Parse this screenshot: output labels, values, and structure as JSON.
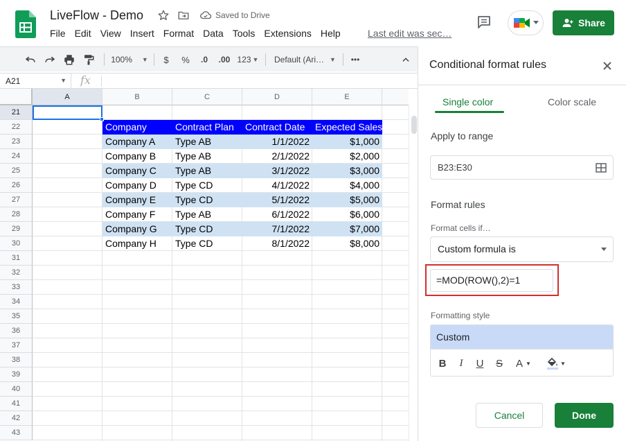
{
  "app": {
    "doc_title": "LiveFlow - Demo",
    "saved_status": "Saved to Drive",
    "last_edit": "Last edit was sec…",
    "share_label": "Share",
    "menu": [
      "File",
      "Edit",
      "View",
      "Insert",
      "Format",
      "Data",
      "Tools",
      "Extensions",
      "Help"
    ]
  },
  "toolbar": {
    "zoom": "100%",
    "currency": "$",
    "percent": "%",
    "decrease_decimals": ".0",
    "increase_decimals": ".00",
    "number_format": "123",
    "font": "Default (Ari…",
    "more": "•••"
  },
  "formula_bar": {
    "name_box": "A21",
    "fx": "fx"
  },
  "sheet": {
    "columns": [
      "A",
      "B",
      "C",
      "D",
      "E"
    ],
    "rows": [
      "21",
      "22",
      "23",
      "24",
      "25",
      "26",
      "27",
      "28",
      "29",
      "30",
      "31",
      "32",
      "33",
      "34",
      "35",
      "36",
      "37",
      "38",
      "39",
      "40",
      "41",
      "42",
      "43"
    ],
    "table_header": [
      "Company",
      "Contract Plan",
      "Contract Date",
      "Expected Sales"
    ],
    "table_rows": [
      [
        "Company A",
        "Type AB",
        "1/1/2022",
        "$1,000"
      ],
      [
        "Company B",
        "Type AB",
        "2/1/2022",
        "$2,000"
      ],
      [
        "Company C",
        "Type AB",
        "3/1/2022",
        "$3,000"
      ],
      [
        "Company D",
        "Type CD",
        "4/1/2022",
        "$4,000"
      ],
      [
        "Company E",
        "Type CD",
        "5/1/2022",
        "$5,000"
      ],
      [
        "Company F",
        "Type AB",
        "6/1/2022",
        "$6,000"
      ],
      [
        "Company G",
        "Type CD",
        "7/1/2022",
        "$7,000"
      ],
      [
        "Company H",
        "Type CD",
        "8/1/2022",
        "$8,000"
      ]
    ],
    "colors": {
      "header_bg": "#0000ff",
      "band_bg": "#cfe2f3"
    }
  },
  "panel": {
    "title": "Conditional format rules",
    "tabs": [
      "Single color",
      "Color scale"
    ],
    "apply_label": "Apply to range",
    "range_value": "B23:E30",
    "rules_label": "Format rules",
    "format_if_label": "Format cells if…",
    "condition": "Custom formula is",
    "formula": "=MOD(ROW(),2)=1",
    "style_label": "Formatting style",
    "style_preview": "Custom",
    "style_tools": [
      "B",
      "I",
      "U",
      "S",
      "A"
    ],
    "style_preview_color": "#c9daf8",
    "cancel_label": "Cancel",
    "done_label": "Done",
    "accent": "#188038"
  }
}
